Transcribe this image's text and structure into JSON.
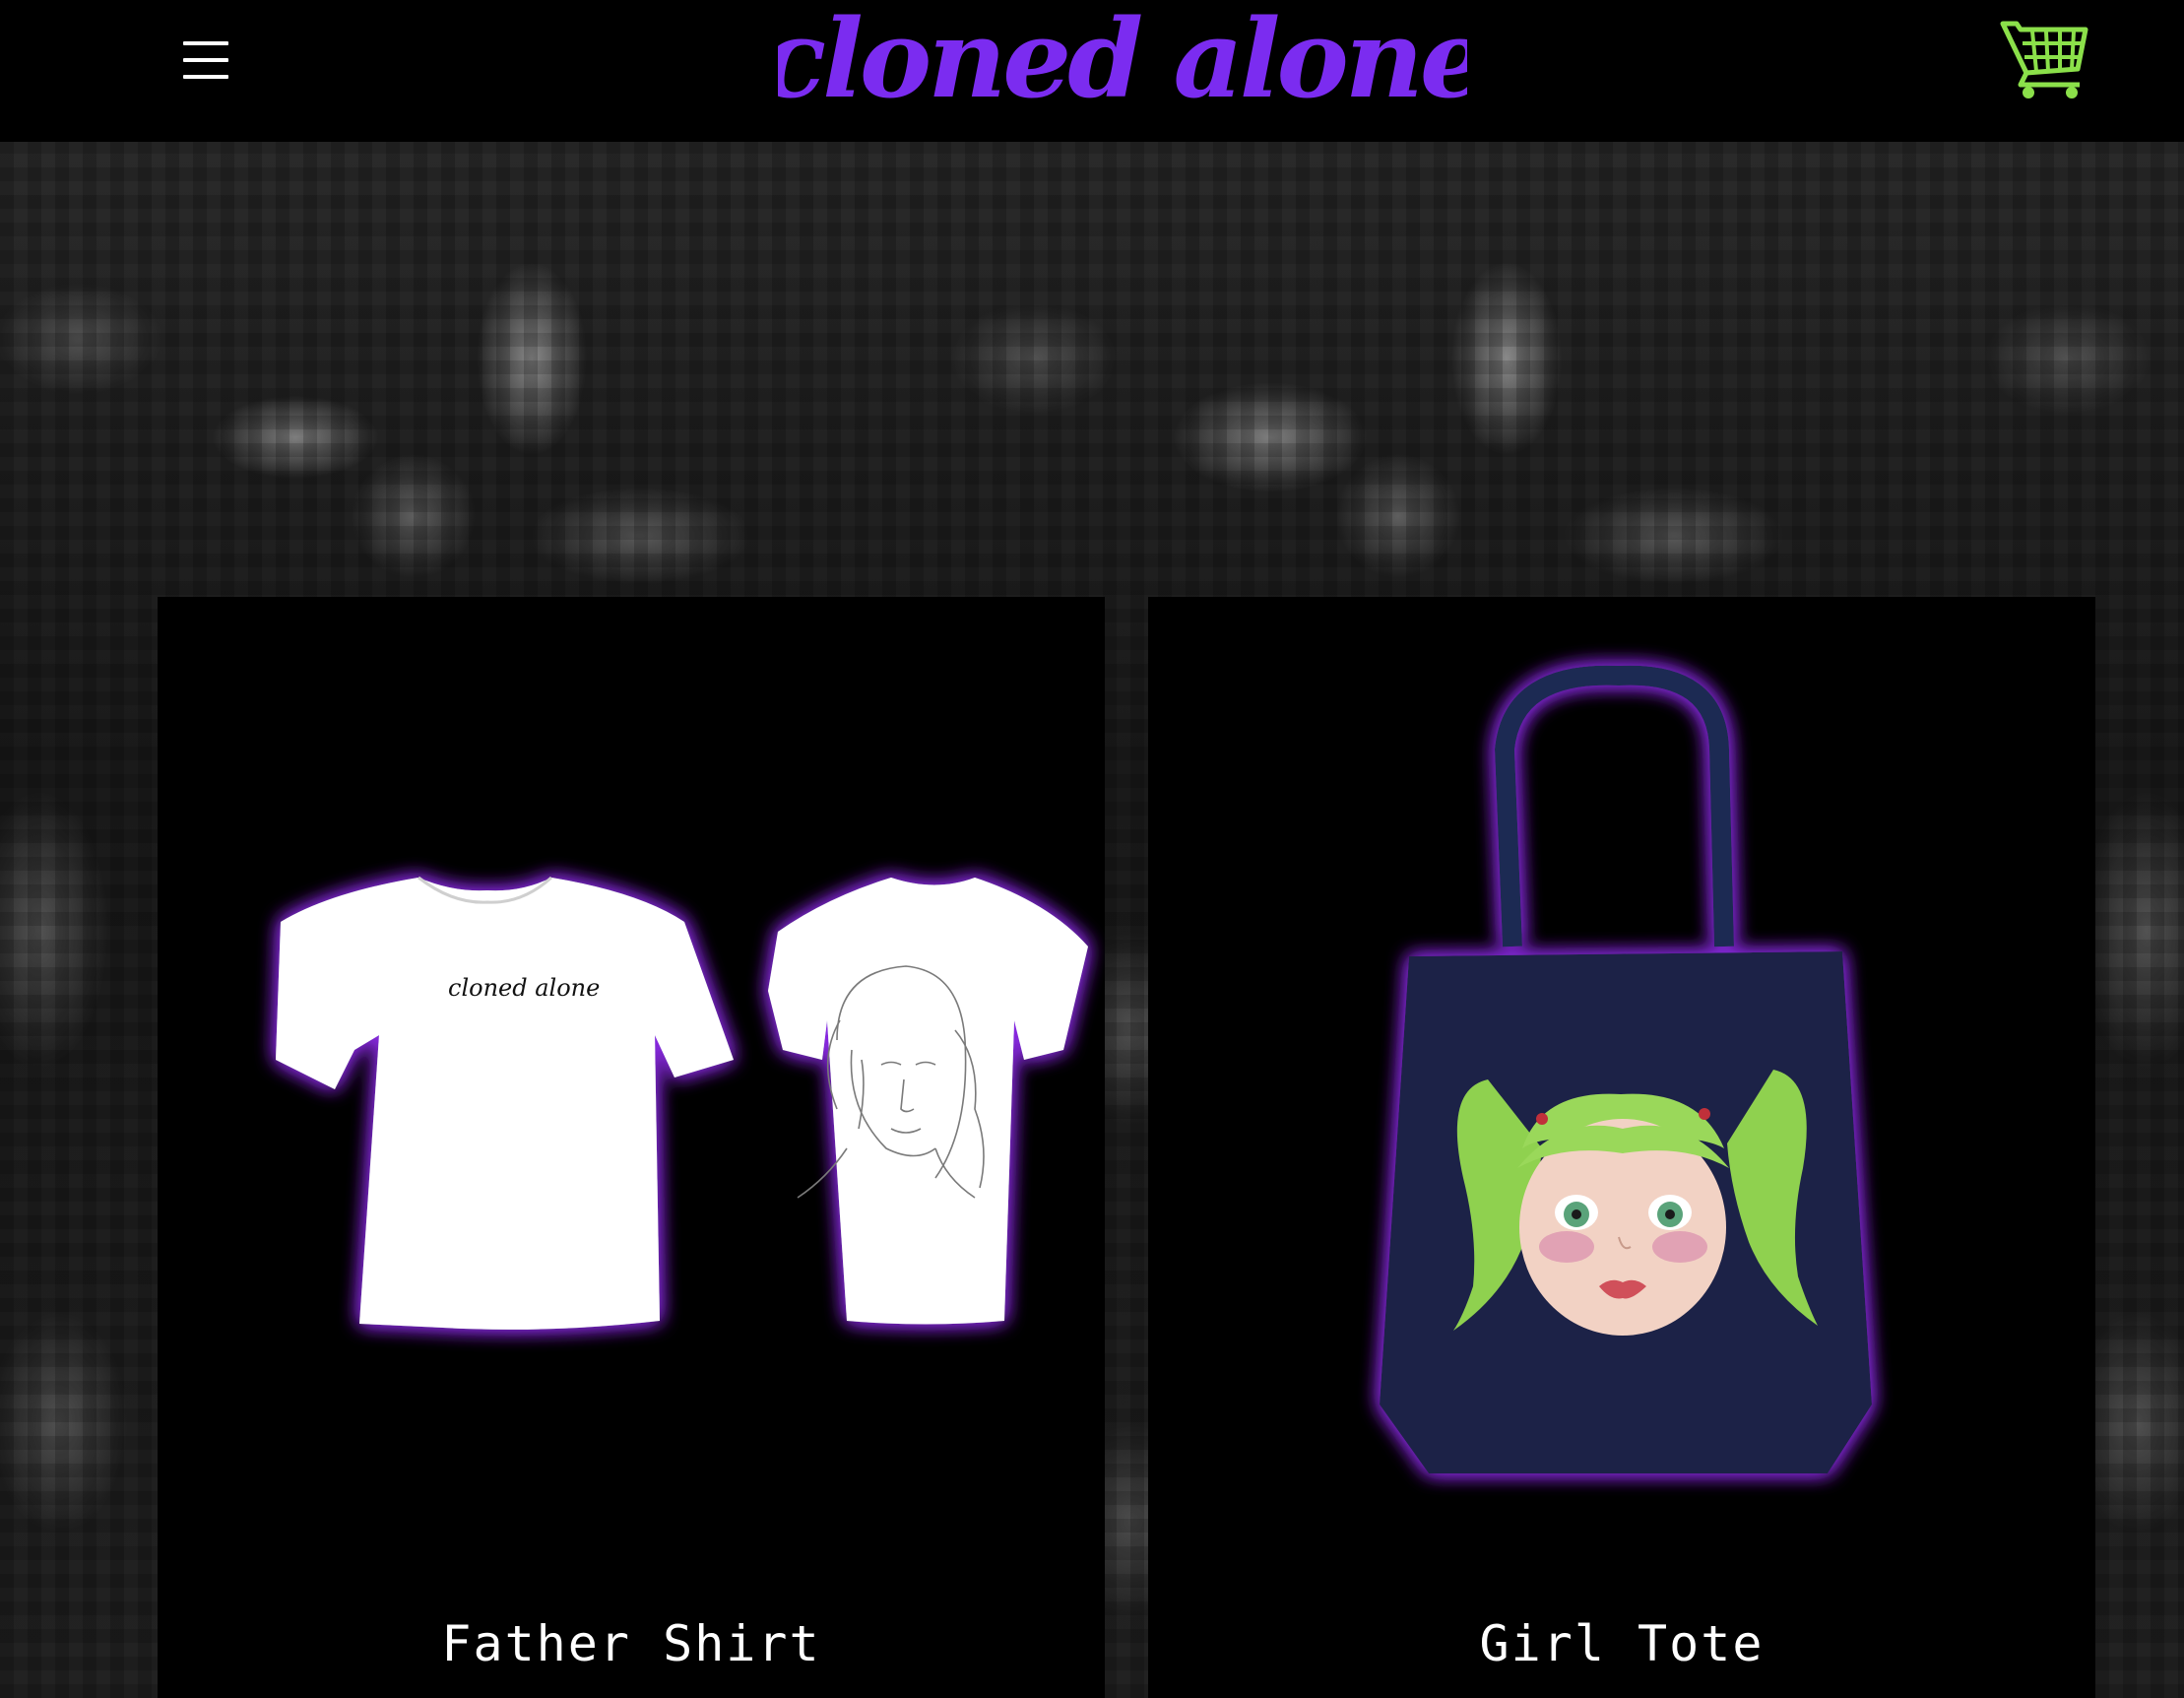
{
  "header": {
    "logo_text": "cloned alone",
    "menu_icon": "hamburger-menu-icon",
    "cart_icon": "shopping-cart-icon"
  },
  "colors": {
    "logo_purple": "#7b2cf0",
    "cart_green": "#8be04a",
    "glow_purple": "#8a2be2",
    "background": "#000000"
  },
  "products": [
    {
      "title": "Father Shirt",
      "front_print": "cloned alone"
    },
    {
      "title": "Girl Tote"
    }
  ]
}
